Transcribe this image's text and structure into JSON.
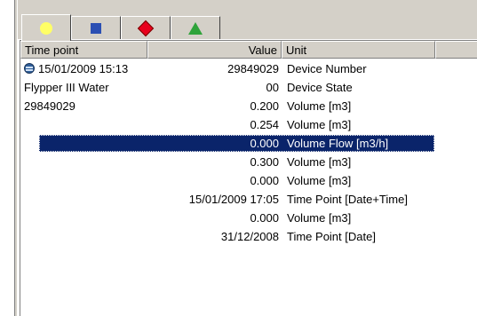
{
  "tabs": [
    {
      "icon": "yellow-circle-icon",
      "color": "#ffff66"
    },
    {
      "icon": "blue-square-icon",
      "color": "#2b4fb3"
    },
    {
      "icon": "red-diamond-icon",
      "color": "#e8001c"
    },
    {
      "icon": "green-triangle-icon",
      "color": "#2fa33a"
    }
  ],
  "columns": {
    "time": "Time point",
    "value": "Value",
    "unit": "Unit"
  },
  "rows": [
    {
      "time": "15/01/2009 15:13",
      "value": "29849029",
      "unit": "Device Number"
    },
    {
      "time": "Flypper III Water",
      "value": "00",
      "unit": "Device State"
    },
    {
      "time": "29849029",
      "value": "0.200",
      "unit": "Volume [m3]"
    },
    {
      "time": "",
      "value": "0.254",
      "unit": "Volume [m3]"
    },
    {
      "time": "",
      "value": "0.000",
      "unit": "Volume Flow [m3/h]"
    },
    {
      "time": "",
      "value": "0.300",
      "unit": "Volume [m3]"
    },
    {
      "time": "",
      "value": "0.000",
      "unit": "Volume [m3]"
    },
    {
      "time": "",
      "value": "15/01/2009 17:05",
      "unit": "Time Point [Date+Time]"
    },
    {
      "time": "",
      "value": "0.000",
      "unit": "Volume [m3]"
    },
    {
      "time": "",
      "value": "31/12/2008",
      "unit": "Time Point [Date]"
    }
  ],
  "selection_color": "#0a246a"
}
